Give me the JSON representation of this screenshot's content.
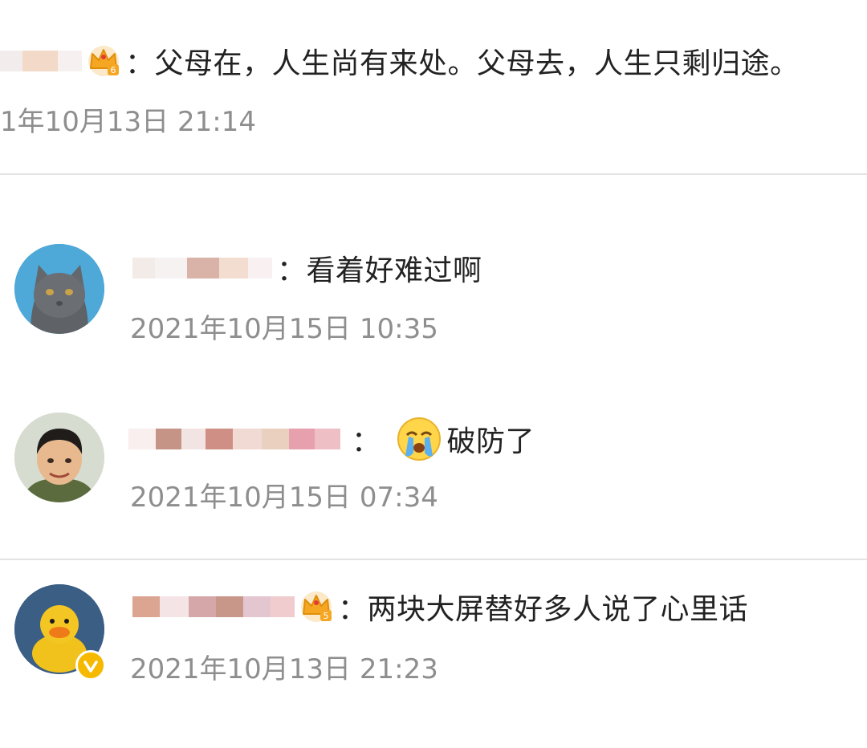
{
  "comments": [
    {
      "separator": "：",
      "text": "父母在，人生尚有来处。父母去，人生只剩归途。",
      "time": "1年10月13日 21:14",
      "avatar_icon": "none",
      "badge_icon": "crown-level-6-icon"
    },
    {
      "separator": "：",
      "text": "看着好难过啊",
      "time": "2021年10月15日 10:35",
      "avatar_icon": "gray-cat-avatar",
      "badge_icon": ""
    },
    {
      "separator": "：",
      "text": "破防了",
      "time": "2021年10月15日 07:34",
      "avatar_icon": "man-in-uniform-avatar",
      "emoji_icon": "crying-face-icon"
    },
    {
      "separator": "：",
      "text": "两块大屏替好多人说了心里话",
      "time": "2021年10月13日 21:23",
      "avatar_icon": "yellow-duck-avatar",
      "badge_icon": "crown-level-5-icon",
      "verified_icon": "verified-v-icon"
    }
  ],
  "colors": {
    "text": "#222222",
    "time": "#8e8e8e",
    "divider": "#e3e3e3",
    "crown": "#f5a623",
    "verified": "#f6b900"
  }
}
